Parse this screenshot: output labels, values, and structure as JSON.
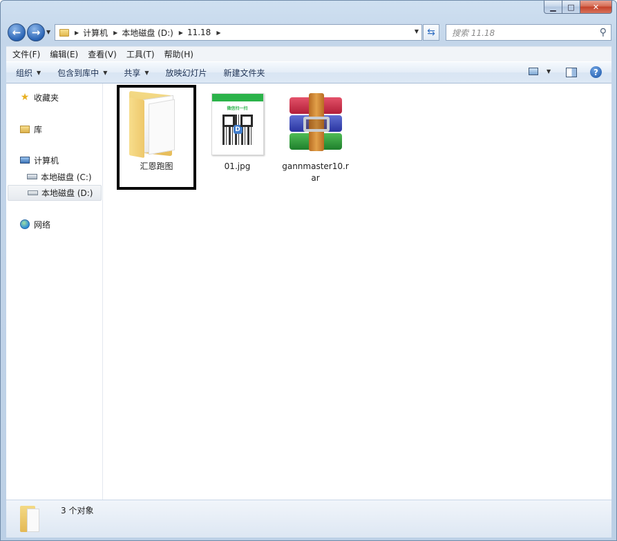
{
  "window": {
    "caption": {
      "minimize": "▁",
      "maximize": "□",
      "close": "✕"
    }
  },
  "nav": {
    "back": "←",
    "forward": "→",
    "breadcrumb": [
      "计算机",
      "本地磁盘 (D:)",
      "11.18"
    ],
    "search_placeholder": "搜索 11.18"
  },
  "menubar": [
    "文件(F)",
    "编辑(E)",
    "查看(V)",
    "工具(T)",
    "帮助(H)"
  ],
  "toolbar": {
    "organize": "组织",
    "include_library": "包含到库中",
    "share": "共享",
    "slideshow": "放映幻灯片",
    "new_folder": "新建文件夹"
  },
  "sidebar": {
    "favorites": "收藏夹",
    "libraries": "库",
    "computer": "计算机",
    "drive_c": "本地磁盘 (C:)",
    "drive_d": "本地磁盘 (D:)",
    "network": "网络"
  },
  "files": [
    {
      "name": "汇恩跑图",
      "type": "folder",
      "selected": true
    },
    {
      "name": "01.jpg",
      "type": "image",
      "selected": false
    },
    {
      "name": "gannmaster10.rar",
      "type": "archive",
      "selected": false
    }
  ],
  "jpg_preview": {
    "title": "微信扫一扫",
    "badge": "D"
  },
  "status": {
    "count_text": "3 个对象"
  },
  "colors": {
    "accent": "#2a64b5",
    "selection_border": "#000000",
    "qr_green": "#2bb34a"
  }
}
